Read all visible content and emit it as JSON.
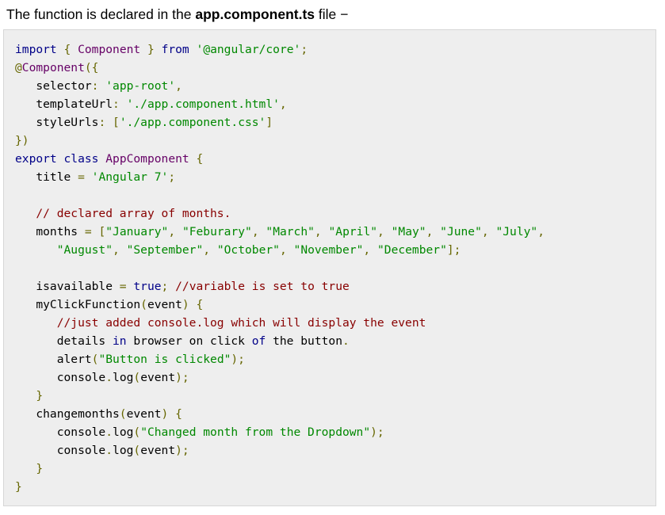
{
  "intro": {
    "prefix": "The function is declared in the ",
    "filename": "app.component.ts",
    "suffix": " file −"
  },
  "code": {
    "language": "typescript",
    "lines": [
      [
        [
          "kw",
          "import"
        ],
        [
          "pln",
          " "
        ],
        [
          "pun",
          "{"
        ],
        [
          "pln",
          " "
        ],
        [
          "typ",
          "Component"
        ],
        [
          "pln",
          " "
        ],
        [
          "pun",
          "}"
        ],
        [
          "pln",
          " "
        ],
        [
          "kw",
          "from"
        ],
        [
          "pln",
          " "
        ],
        [
          "str",
          "'@angular/core'"
        ],
        [
          "pun",
          ";"
        ]
      ],
      [
        [
          "pun",
          "@"
        ],
        [
          "typ",
          "Component"
        ],
        [
          "pun",
          "({"
        ]
      ],
      [
        [
          "pln",
          "   selector"
        ],
        [
          "pun",
          ":"
        ],
        [
          "pln",
          " "
        ],
        [
          "str",
          "'app-root'"
        ],
        [
          "pun",
          ","
        ]
      ],
      [
        [
          "pln",
          "   templateUrl"
        ],
        [
          "pun",
          ":"
        ],
        [
          "pln",
          " "
        ],
        [
          "str",
          "'./app.component.html'"
        ],
        [
          "pun",
          ","
        ]
      ],
      [
        [
          "pln",
          "   styleUrls"
        ],
        [
          "pun",
          ":"
        ],
        [
          "pln",
          " "
        ],
        [
          "pun",
          "["
        ],
        [
          "str",
          "'./app.component.css'"
        ],
        [
          "pun",
          "]"
        ]
      ],
      [
        [
          "pun",
          "})"
        ]
      ],
      [
        [
          "kw",
          "export"
        ],
        [
          "pln",
          " "
        ],
        [
          "kw",
          "class"
        ],
        [
          "pln",
          " "
        ],
        [
          "typ",
          "AppComponent"
        ],
        [
          "pln",
          " "
        ],
        [
          "pun",
          "{"
        ]
      ],
      [
        [
          "pln",
          "   title "
        ],
        [
          "pun",
          "="
        ],
        [
          "pln",
          " "
        ],
        [
          "str",
          "'Angular 7'"
        ],
        [
          "pun",
          ";"
        ]
      ],
      [],
      [
        [
          "pln",
          "   "
        ],
        [
          "com",
          "// declared array of months."
        ]
      ],
      [
        [
          "pln",
          "   months "
        ],
        [
          "pun",
          "="
        ],
        [
          "pln",
          " "
        ],
        [
          "pun",
          "["
        ],
        [
          "str",
          "\"January\""
        ],
        [
          "pun",
          ","
        ],
        [
          "pln",
          " "
        ],
        [
          "str",
          "\"Feburary\""
        ],
        [
          "pun",
          ","
        ],
        [
          "pln",
          " "
        ],
        [
          "str",
          "\"March\""
        ],
        [
          "pun",
          ","
        ],
        [
          "pln",
          " "
        ],
        [
          "str",
          "\"April\""
        ],
        [
          "pun",
          ","
        ],
        [
          "pln",
          " "
        ],
        [
          "str",
          "\"May\""
        ],
        [
          "pun",
          ","
        ],
        [
          "pln",
          " "
        ],
        [
          "str",
          "\"June\""
        ],
        [
          "pun",
          ","
        ],
        [
          "pln",
          " "
        ],
        [
          "str",
          "\"July\""
        ],
        [
          "pun",
          ","
        ]
      ],
      [
        [
          "pln",
          "      "
        ],
        [
          "str",
          "\"August\""
        ],
        [
          "pun",
          ","
        ],
        [
          "pln",
          " "
        ],
        [
          "str",
          "\"September\""
        ],
        [
          "pun",
          ","
        ],
        [
          "pln",
          " "
        ],
        [
          "str",
          "\"October\""
        ],
        [
          "pun",
          ","
        ],
        [
          "pln",
          " "
        ],
        [
          "str",
          "\"November\""
        ],
        [
          "pun",
          ","
        ],
        [
          "pln",
          " "
        ],
        [
          "str",
          "\"December\""
        ],
        [
          "pun",
          "];"
        ]
      ],
      [],
      [
        [
          "pln",
          "   isavailable "
        ],
        [
          "pun",
          "="
        ],
        [
          "pln",
          " "
        ],
        [
          "kw",
          "true"
        ],
        [
          "pun",
          ";"
        ],
        [
          "pln",
          " "
        ],
        [
          "com",
          "//variable is set to true"
        ]
      ],
      [
        [
          "pln",
          "   myClickFunction"
        ],
        [
          "pun",
          "("
        ],
        [
          "pln",
          "event"
        ],
        [
          "pun",
          ")"
        ],
        [
          "pln",
          " "
        ],
        [
          "pun",
          "{"
        ]
      ],
      [
        [
          "pln",
          "      "
        ],
        [
          "com",
          "//just added console.log which will display the event"
        ]
      ],
      [
        [
          "pln",
          "      details "
        ],
        [
          "kw",
          "in"
        ],
        [
          "pln",
          " browser on click "
        ],
        [
          "kw",
          "of"
        ],
        [
          "pln",
          " the button"
        ],
        [
          "pun",
          "."
        ]
      ],
      [
        [
          "pln",
          "      alert"
        ],
        [
          "pun",
          "("
        ],
        [
          "str",
          "\"Button is clicked\""
        ],
        [
          "pun",
          ");"
        ]
      ],
      [
        [
          "pln",
          "      console"
        ],
        [
          "pun",
          "."
        ],
        [
          "pln",
          "log"
        ],
        [
          "pun",
          "("
        ],
        [
          "pln",
          "event"
        ],
        [
          "pun",
          ");"
        ]
      ],
      [
        [
          "pln",
          "   "
        ],
        [
          "pun",
          "}"
        ]
      ],
      [
        [
          "pln",
          "   changemonths"
        ],
        [
          "pun",
          "("
        ],
        [
          "pln",
          "event"
        ],
        [
          "pun",
          ")"
        ],
        [
          "pln",
          " "
        ],
        [
          "pun",
          "{"
        ]
      ],
      [
        [
          "pln",
          "      console"
        ],
        [
          "pun",
          "."
        ],
        [
          "pln",
          "log"
        ],
        [
          "pun",
          "("
        ],
        [
          "str",
          "\"Changed month from the Dropdown\""
        ],
        [
          "pun",
          ");"
        ]
      ],
      [
        [
          "pln",
          "      console"
        ],
        [
          "pun",
          "."
        ],
        [
          "pln",
          "log"
        ],
        [
          "pun",
          "("
        ],
        [
          "pln",
          "event"
        ],
        [
          "pun",
          ");"
        ]
      ],
      [
        [
          "pln",
          "   "
        ],
        [
          "pun",
          "}"
        ]
      ],
      [
        [
          "pun",
          "}"
        ]
      ]
    ]
  }
}
